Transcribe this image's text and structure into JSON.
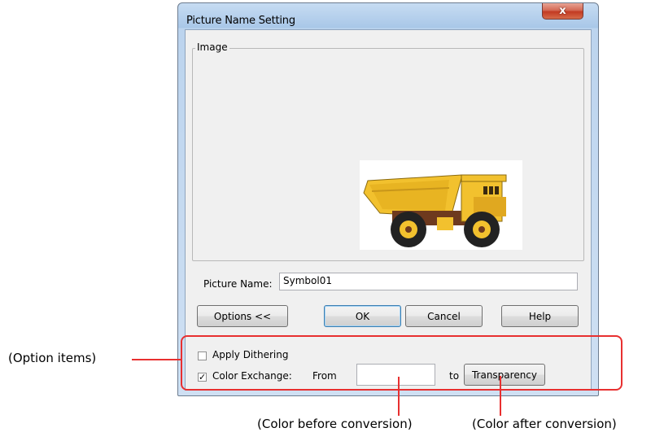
{
  "dialog": {
    "title": "Picture Name Setting",
    "close_glyph": "x",
    "image_group_label": "Image",
    "picture_name_label": "Picture Name:",
    "picture_name_value": "Symbol01",
    "buttons": {
      "options": "Options <<",
      "ok": "OK",
      "cancel": "Cancel",
      "help": "Help"
    },
    "options": {
      "apply_dithering_label": "Apply Dithering",
      "apply_dithering_checked": false,
      "color_exchange_label": "Color Exchange:",
      "color_exchange_checked": true,
      "check_glyph": "✓",
      "from_label": "From",
      "from_value": "",
      "to_label": "to",
      "transparency_button": "Transparency"
    }
  },
  "annotations": {
    "option_items": "(Option items)",
    "color_before": "(Color before conversion)",
    "color_after": "(Color after conversion)"
  },
  "colors": {
    "annotation_red": "#e83030",
    "truck_yellow": "#f2c12e",
    "truck_dark": "#6e3a1e"
  }
}
